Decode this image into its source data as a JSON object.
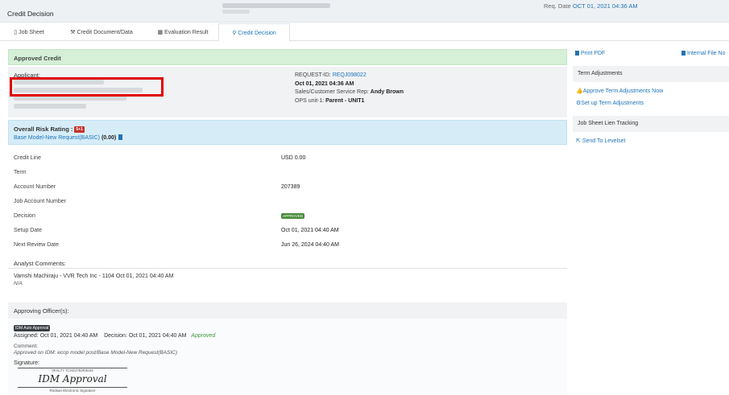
{
  "header": {
    "title": "Credit Decision",
    "req_date_label": "Req. Date",
    "req_date_value": "OCT 01, 2021 04:36 AM"
  },
  "tabs": [
    {
      "label": "Job Sheet",
      "icon": "document-icon"
    },
    {
      "label": "Credit Document/Data",
      "icon": "wrench-icon"
    },
    {
      "label": "Evaluation Result",
      "icon": "grid-icon"
    },
    {
      "label": "Credit Decision",
      "icon": "pin-icon"
    }
  ],
  "status_bar": {
    "label": "Approved Credit"
  },
  "applicant": {
    "label": "Applicant:",
    "request_id_label": "REQUEST-ID:",
    "request_id": "REQJ098022",
    "date": "Oct 01, 2021 04:36 AM",
    "sales_rep_label": "Sales/Customer Service Rep:",
    "sales_rep": "Andy Brown",
    "ops_unit_label": "OPS unit-1:",
    "ops_unit": "Parent - UNIT1"
  },
  "risk": {
    "label": "Overall Risk Rating :",
    "badge": "5+1",
    "model": "Base Model-New Request(BASIC)",
    "score": "(0.00)"
  },
  "details": [
    {
      "key": "Credit Line",
      "value": "USD 0.00"
    },
    {
      "key": "Term",
      "value": ""
    },
    {
      "key": "Account Number",
      "value": "207389"
    },
    {
      "key": "Job Account Number",
      "value": ""
    },
    {
      "key": "Decision",
      "value": "APPROVED"
    },
    {
      "key": "Setup Date",
      "value": "Oct 01, 2021 04:40 AM"
    },
    {
      "key": "Next Review Date",
      "value": "Jun 26, 2024 04:40 AM"
    }
  ],
  "comments": {
    "label": "Analyst Comments:",
    "line1": "Vamshi Machiraju - VVR Tech Inc - 1104 Oct 01, 2021 04:40 AM",
    "line2": "N/A"
  },
  "officers": {
    "label": "Approving Officer(s):",
    "badge": "IDM Auto Approval",
    "assigned_label": "Assigned:",
    "assigned": "Oct 01, 2021 04:40 AM",
    "decision_label": "Decision:",
    "decision": "Oct 01, 2021 04:40 AM",
    "status": "Approved",
    "comment_label": "Comment:",
    "comment": "Approved on IDM: ecop model post/Base Model-New Request(BASIC)",
    "signature_label": "Signature:",
    "signature_id": "0FAL77 7CXDJ79JR3044",
    "signature_script": "IDM Approval",
    "signature_caption": "Redsan Electronic Signature"
  },
  "sidebar": {
    "print_pdf": "Print PDF",
    "internal_file": "Internal File No",
    "term_adjustments_title": "Term Adjustments",
    "approve_term": "Approve Term Adjustments Now",
    "setup_term": "Set up Term Adjustments",
    "lien_title": "Job Sheet Lien Tracking",
    "send_levelset": "Send To Levelset"
  },
  "colors": {
    "accent": "#1f74b7",
    "approved_green": "#d5f0d7",
    "risk_blue": "#d6edf8",
    "highlight_red": "#e00000"
  }
}
